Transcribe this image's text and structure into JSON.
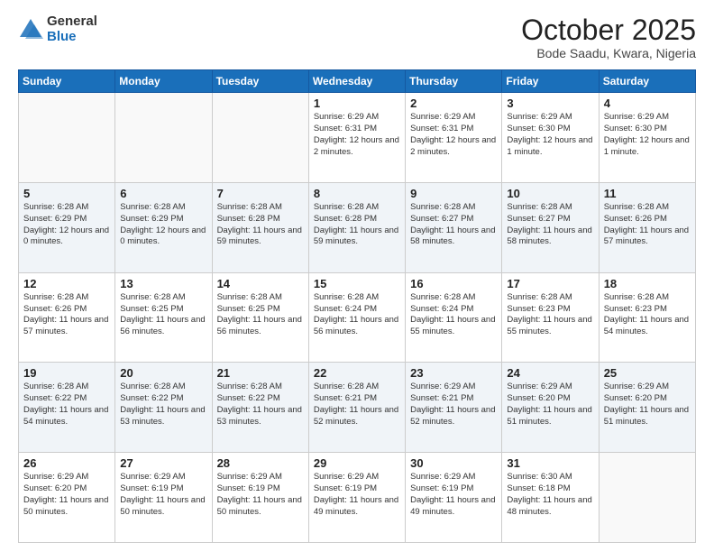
{
  "header": {
    "logo_general": "General",
    "logo_blue": "Blue",
    "month": "October 2025",
    "location": "Bode Saadu, Kwara, Nigeria"
  },
  "weekdays": [
    "Sunday",
    "Monday",
    "Tuesday",
    "Wednesday",
    "Thursday",
    "Friday",
    "Saturday"
  ],
  "weeks": [
    [
      {
        "day": "",
        "info": ""
      },
      {
        "day": "",
        "info": ""
      },
      {
        "day": "",
        "info": ""
      },
      {
        "day": "1",
        "info": "Sunrise: 6:29 AM\nSunset: 6:31 PM\nDaylight: 12 hours and 2 minutes."
      },
      {
        "day": "2",
        "info": "Sunrise: 6:29 AM\nSunset: 6:31 PM\nDaylight: 12 hours and 2 minutes."
      },
      {
        "day": "3",
        "info": "Sunrise: 6:29 AM\nSunset: 6:30 PM\nDaylight: 12 hours and 1 minute."
      },
      {
        "day": "4",
        "info": "Sunrise: 6:29 AM\nSunset: 6:30 PM\nDaylight: 12 hours and 1 minute."
      }
    ],
    [
      {
        "day": "5",
        "info": "Sunrise: 6:28 AM\nSunset: 6:29 PM\nDaylight: 12 hours and 0 minutes."
      },
      {
        "day": "6",
        "info": "Sunrise: 6:28 AM\nSunset: 6:29 PM\nDaylight: 12 hours and 0 minutes."
      },
      {
        "day": "7",
        "info": "Sunrise: 6:28 AM\nSunset: 6:28 PM\nDaylight: 11 hours and 59 minutes."
      },
      {
        "day": "8",
        "info": "Sunrise: 6:28 AM\nSunset: 6:28 PM\nDaylight: 11 hours and 59 minutes."
      },
      {
        "day": "9",
        "info": "Sunrise: 6:28 AM\nSunset: 6:27 PM\nDaylight: 11 hours and 58 minutes."
      },
      {
        "day": "10",
        "info": "Sunrise: 6:28 AM\nSunset: 6:27 PM\nDaylight: 11 hours and 58 minutes."
      },
      {
        "day": "11",
        "info": "Sunrise: 6:28 AM\nSunset: 6:26 PM\nDaylight: 11 hours and 57 minutes."
      }
    ],
    [
      {
        "day": "12",
        "info": "Sunrise: 6:28 AM\nSunset: 6:26 PM\nDaylight: 11 hours and 57 minutes."
      },
      {
        "day": "13",
        "info": "Sunrise: 6:28 AM\nSunset: 6:25 PM\nDaylight: 11 hours and 56 minutes."
      },
      {
        "day": "14",
        "info": "Sunrise: 6:28 AM\nSunset: 6:25 PM\nDaylight: 11 hours and 56 minutes."
      },
      {
        "day": "15",
        "info": "Sunrise: 6:28 AM\nSunset: 6:24 PM\nDaylight: 11 hours and 56 minutes."
      },
      {
        "day": "16",
        "info": "Sunrise: 6:28 AM\nSunset: 6:24 PM\nDaylight: 11 hours and 55 minutes."
      },
      {
        "day": "17",
        "info": "Sunrise: 6:28 AM\nSunset: 6:23 PM\nDaylight: 11 hours and 55 minutes."
      },
      {
        "day": "18",
        "info": "Sunrise: 6:28 AM\nSunset: 6:23 PM\nDaylight: 11 hours and 54 minutes."
      }
    ],
    [
      {
        "day": "19",
        "info": "Sunrise: 6:28 AM\nSunset: 6:22 PM\nDaylight: 11 hours and 54 minutes."
      },
      {
        "day": "20",
        "info": "Sunrise: 6:28 AM\nSunset: 6:22 PM\nDaylight: 11 hours and 53 minutes."
      },
      {
        "day": "21",
        "info": "Sunrise: 6:28 AM\nSunset: 6:22 PM\nDaylight: 11 hours and 53 minutes."
      },
      {
        "day": "22",
        "info": "Sunrise: 6:28 AM\nSunset: 6:21 PM\nDaylight: 11 hours and 52 minutes."
      },
      {
        "day": "23",
        "info": "Sunrise: 6:29 AM\nSunset: 6:21 PM\nDaylight: 11 hours and 52 minutes."
      },
      {
        "day": "24",
        "info": "Sunrise: 6:29 AM\nSunset: 6:20 PM\nDaylight: 11 hours and 51 minutes."
      },
      {
        "day": "25",
        "info": "Sunrise: 6:29 AM\nSunset: 6:20 PM\nDaylight: 11 hours and 51 minutes."
      }
    ],
    [
      {
        "day": "26",
        "info": "Sunrise: 6:29 AM\nSunset: 6:20 PM\nDaylight: 11 hours and 50 minutes."
      },
      {
        "day": "27",
        "info": "Sunrise: 6:29 AM\nSunset: 6:19 PM\nDaylight: 11 hours and 50 minutes."
      },
      {
        "day": "28",
        "info": "Sunrise: 6:29 AM\nSunset: 6:19 PM\nDaylight: 11 hours and 50 minutes."
      },
      {
        "day": "29",
        "info": "Sunrise: 6:29 AM\nSunset: 6:19 PM\nDaylight: 11 hours and 49 minutes."
      },
      {
        "day": "30",
        "info": "Sunrise: 6:29 AM\nSunset: 6:19 PM\nDaylight: 11 hours and 49 minutes."
      },
      {
        "day": "31",
        "info": "Sunrise: 6:30 AM\nSunset: 6:18 PM\nDaylight: 11 hours and 48 minutes."
      },
      {
        "day": "",
        "info": ""
      }
    ]
  ],
  "row_shades": [
    false,
    true,
    false,
    true,
    false
  ]
}
